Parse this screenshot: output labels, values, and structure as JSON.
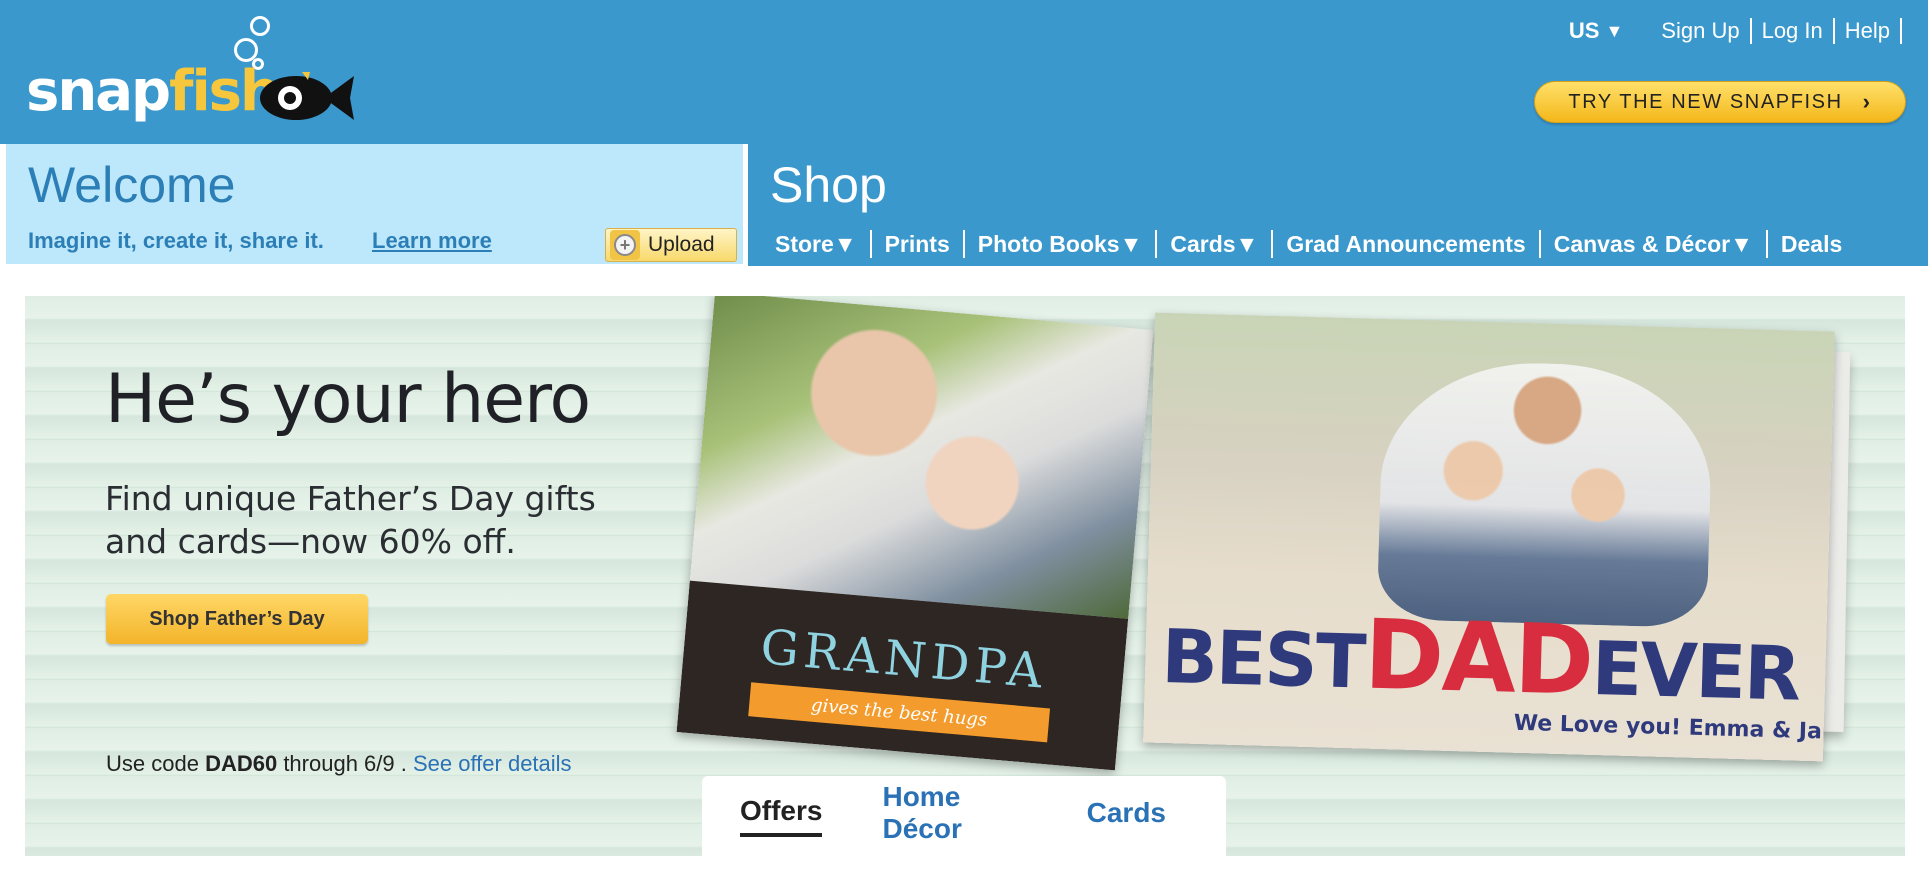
{
  "header": {
    "logo_text_snap": "snap",
    "logo_text_fish": "fish",
    "region": "US",
    "util_links": [
      "Sign Up",
      "Log In",
      "Help"
    ],
    "try_new_button": "TRY THE NEW SNAPFISH"
  },
  "welcome": {
    "title": "Welcome",
    "tagline": "Imagine it, create it, share it.",
    "learn_more": "Learn more",
    "upload_label": "Upload"
  },
  "shop": {
    "title": "Shop",
    "nav": [
      "Store▼",
      "Prints",
      "Photo Books▼",
      "Cards▼",
      "Grad Announcements",
      "Canvas & Décor▼",
      "Deals"
    ]
  },
  "hero": {
    "headline": "He’s your hero",
    "subtext": "Find unique Father’s Day gifts and cards—now 60% off.",
    "cta": "Shop Father’s Day",
    "promo_prefix": "Use code ",
    "promo_code": "DAD60",
    "promo_suffix": " through 6/9 . ",
    "offer_link": "See offer details",
    "grandpa_card_title": "GRANDPA",
    "grandpa_card_ribbon": "gives the best hugs",
    "dad_card_best": "BEST",
    "dad_card_dad": "DAD",
    "dad_card_ever": "EVER",
    "dad_card_sign": "We Love you! Emma & Jane",
    "tabs": [
      "Offers",
      "Home Décor",
      "Cards"
    ],
    "active_tab": "Offers"
  },
  "colors": {
    "header_blue": "#3a98cd",
    "welcome_bg": "#bde7fa",
    "button_yellow": "#f4b71a",
    "link_blue": "#2a72b5"
  }
}
